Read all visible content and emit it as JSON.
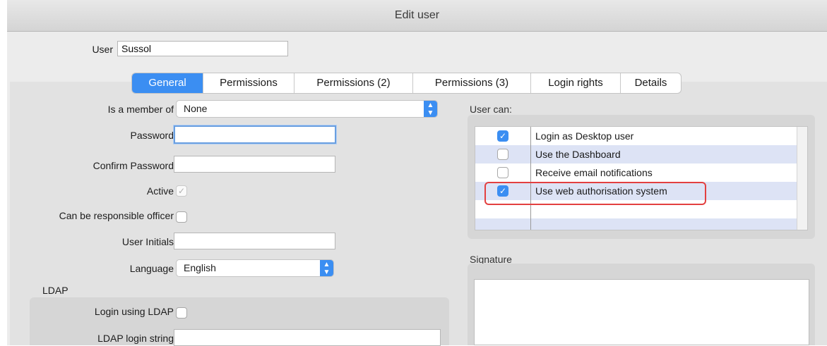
{
  "window": {
    "title": "Edit user"
  },
  "user_field": {
    "label": "User",
    "value": "Sussol"
  },
  "tabs": [
    {
      "label": "General"
    },
    {
      "label": "Permissions"
    },
    {
      "label": "Permissions (2)"
    },
    {
      "label": "Permissions (3)"
    },
    {
      "label": "Login rights"
    },
    {
      "label": "Details"
    }
  ],
  "general": {
    "member_of": {
      "label": "Is a member of",
      "value": "None"
    },
    "password": {
      "label": "Password",
      "value": ""
    },
    "confirm_password": {
      "label": "Confirm Password",
      "value": ""
    },
    "active": {
      "label": "Active",
      "checked": true
    },
    "responsible_officer": {
      "label": "Can be responsible officer",
      "checked": false
    },
    "user_initials": {
      "label": "User Initials",
      "value": ""
    },
    "language": {
      "label": "Language",
      "value": "English"
    },
    "ldap": {
      "section_label": "LDAP",
      "login_using_ldap": {
        "label": "Login using LDAP",
        "checked": false
      },
      "login_string": {
        "label": "LDAP login string",
        "value": ""
      }
    }
  },
  "user_can": {
    "label": "User can:",
    "items": [
      {
        "label": "Login as Desktop user",
        "checked": true
      },
      {
        "label": "Use the Dashboard",
        "checked": false
      },
      {
        "label": "Receive email notifications",
        "checked": false
      },
      {
        "label": "Use web authorisation system",
        "checked": true
      }
    ]
  },
  "signature": {
    "label": "Signature"
  },
  "colors": {
    "accent": "#3b8ef2",
    "highlight": "#e34040",
    "row_alt": "#dde3f5"
  }
}
